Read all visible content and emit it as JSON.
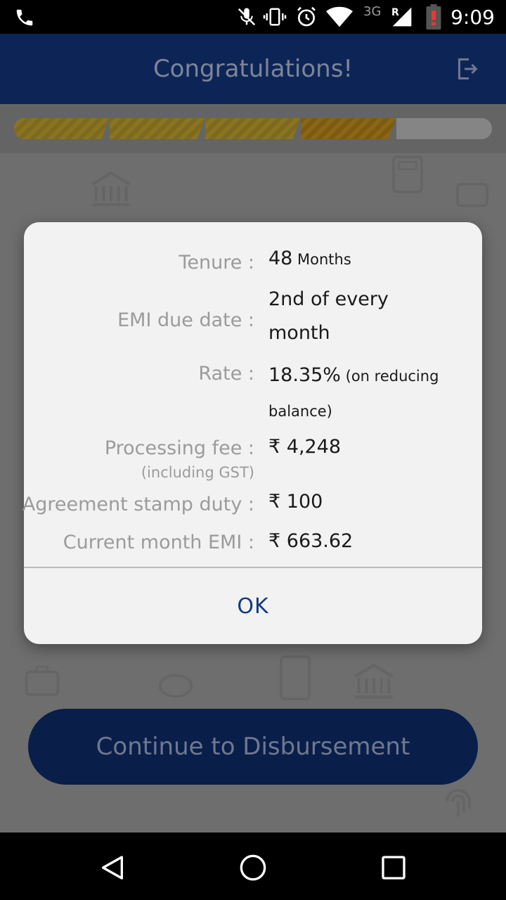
{
  "status_bar": {
    "time": "9:09",
    "network": "3G",
    "roaming": "R",
    "icons": [
      "phone-icon",
      "mic-off-icon",
      "vibrate-icon",
      "alarm-icon",
      "wifi-icon",
      "signal-icon",
      "battery-low-icon"
    ]
  },
  "header": {
    "title": "Congratulations!",
    "action_icon": "logout-icon"
  },
  "progress": {
    "segments_total": 5,
    "segments_completed": 4,
    "current_segment": 4
  },
  "dialog": {
    "rows": [
      {
        "label": "Tenure :",
        "value": "48",
        "value_small": " Months"
      },
      {
        "label": "EMI due date :",
        "value_line1": "2nd of every",
        "value_line2": "month"
      },
      {
        "label": "Rate :",
        "value": "18.35%",
        "value_small": " (on reducing",
        "value_line2": "balance)"
      },
      {
        "label": "Processing fee :",
        "sublabel": "(including GST)",
        "value": "₹ 4,248"
      },
      {
        "label": "Agreement stamp duty :",
        "value": "₹ 100"
      },
      {
        "label": "Current month EMI :",
        "value": "₹ 663.62"
      }
    ],
    "ok_label": "OK"
  },
  "cta": {
    "label": "Continue to Disbursement"
  },
  "colors": {
    "header_bg": "#0d2556",
    "ok_text": "#113b82",
    "progress_gold": "#8a7420"
  }
}
